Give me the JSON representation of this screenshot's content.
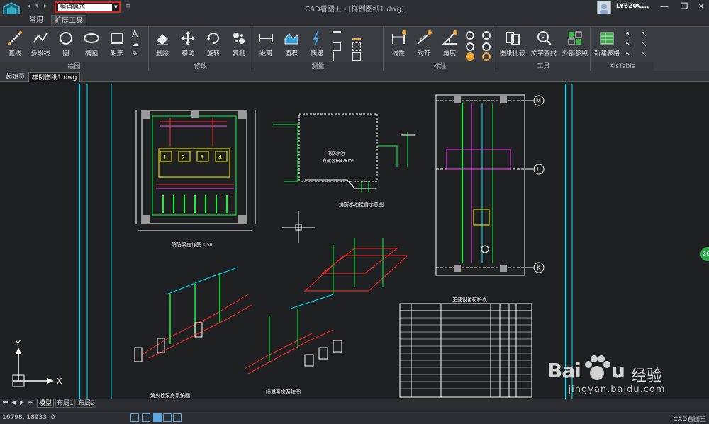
{
  "title_bar": {
    "mode_value": "编辑模式",
    "window_title": "CAD看图王 - [样例图纸1.dwg]",
    "username": "LY620C..."
  },
  "ribbon_tabs": [
    "常用",
    "扩展工具"
  ],
  "ribbon": {
    "draw": {
      "label": "绘图",
      "tools": [
        "直线",
        "多段线",
        "圆",
        "椭圆",
        "矩形"
      ]
    },
    "modify": {
      "label": "修改",
      "tools": [
        "删除",
        "移动",
        "旋转",
        "复制"
      ]
    },
    "measure": {
      "label": "测量",
      "tools": [
        "距离",
        "面积",
        "快速"
      ]
    },
    "annotate": {
      "label": "标注",
      "tools": [
        "线性",
        "对齐",
        "角度"
      ]
    },
    "tools": {
      "label": "工具",
      "tools": [
        "图纸比较",
        "文字查找",
        "外部参照"
      ]
    },
    "xlstable": {
      "label": "XlsTable",
      "tools": [
        "新建表格"
      ]
    }
  },
  "doc_tabs": [
    "起始页",
    "样例图纸1.dwg"
  ],
  "layout_tabs": [
    "模型",
    "布局1",
    "布局2"
  ],
  "drawing": {
    "pump_room_title": "消防泵房详图",
    "pump_room_scale": "1:50",
    "tank_title": "消防水池接管示意图",
    "tank_label_1": "消防水池",
    "tank_label_2": "有效容积376m³",
    "iso_left_title": "消火栓泵房系统图",
    "iso_center_title": "喷淋泵房系统图",
    "table_title": "主要设备材料表",
    "axis_m": "M",
    "axis_l": "L",
    "axis_k": "K",
    "ucs_y": "Y",
    "ucs_x": "X"
  },
  "status_bar": {
    "coords": "16798, 18933, 0",
    "app_name": "CAD看图王"
  },
  "watermark": {
    "brand": "Bai",
    "cn": "经验",
    "url": "jingyan.baidu.com"
  },
  "side_badge": "26",
  "colors": {
    "canvas": "#1f2022",
    "cyan": "#00e5ff",
    "green": "#00ff3c",
    "yellow": "#ffff00",
    "red": "#ff2a2a",
    "magenta": "#ff3cff",
    "white": "#ffffff",
    "highlight": "#d9251d"
  }
}
